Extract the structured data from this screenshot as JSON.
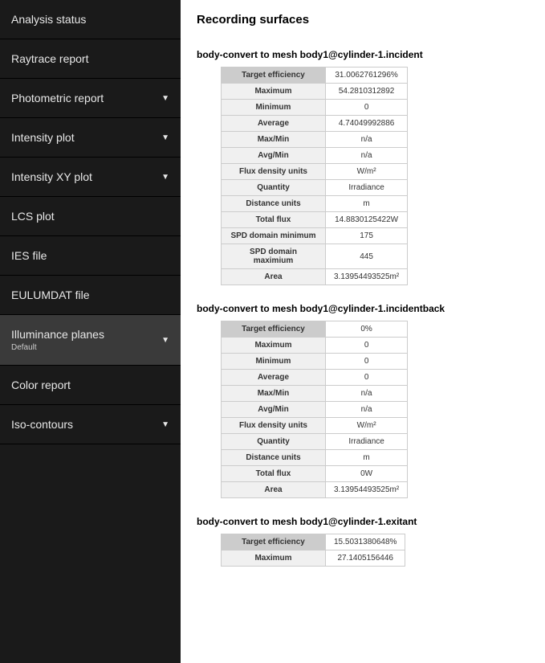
{
  "sidebar": {
    "items": [
      {
        "label": "Analysis status",
        "hasChevron": false,
        "selected": false
      },
      {
        "label": "Raytrace report",
        "hasChevron": false,
        "selected": false
      },
      {
        "label": "Photometric report",
        "hasChevron": true,
        "selected": false
      },
      {
        "label": "Intensity plot",
        "hasChevron": true,
        "selected": false
      },
      {
        "label": "Intensity XY plot",
        "hasChevron": true,
        "selected": false
      },
      {
        "label": "LCS plot",
        "hasChevron": false,
        "selected": false
      },
      {
        "label": "IES file",
        "hasChevron": false,
        "selected": false
      },
      {
        "label": "EULUMDAT file",
        "hasChevron": false,
        "selected": false
      },
      {
        "label": "Illuminance planes",
        "sublabel": "Default",
        "hasChevron": true,
        "selected": true
      },
      {
        "label": "Color report",
        "hasChevron": false,
        "selected": false
      },
      {
        "label": "Iso-contours",
        "hasChevron": true,
        "selected": false
      }
    ]
  },
  "main": {
    "title": "Recording surfaces",
    "sections": [
      {
        "title": "body-convert to mesh body1@cylinder-1.incident",
        "rows": [
          {
            "label": "Target efficiency",
            "value": "31.0062761296%",
            "highlight": true
          },
          {
            "label": "Maximum",
            "value": "54.2810312892"
          },
          {
            "label": "Minimum",
            "value": "0"
          },
          {
            "label": "Average",
            "value": "4.74049992886"
          },
          {
            "label": "Max/Min",
            "value": "n/a"
          },
          {
            "label": "Avg/Min",
            "value": "n/a"
          },
          {
            "label": "Flux density units",
            "value": "W/m²"
          },
          {
            "label": "Quantity",
            "value": "Irradiance"
          },
          {
            "label": "Distance units",
            "value": "m"
          },
          {
            "label": "Total flux",
            "value": "14.8830125422W"
          },
          {
            "label": "SPD domain minimum",
            "value": "175"
          },
          {
            "label": "SPD domain maximium",
            "value": "445"
          },
          {
            "label": "Area",
            "value": "3.13954493525m²"
          }
        ]
      },
      {
        "title": "body-convert to mesh body1@cylinder-1.incidentback",
        "rows": [
          {
            "label": "Target efficiency",
            "value": "0%",
            "highlight": true
          },
          {
            "label": "Maximum",
            "value": "0"
          },
          {
            "label": "Minimum",
            "value": "0"
          },
          {
            "label": "Average",
            "value": "0"
          },
          {
            "label": "Max/Min",
            "value": "n/a"
          },
          {
            "label": "Avg/Min",
            "value": "n/a"
          },
          {
            "label": "Flux density units",
            "value": "W/m²"
          },
          {
            "label": "Quantity",
            "value": "Irradiance"
          },
          {
            "label": "Distance units",
            "value": "m"
          },
          {
            "label": "Total flux",
            "value": "0W"
          },
          {
            "label": "Area",
            "value": "3.13954493525m²"
          }
        ]
      },
      {
        "title": "body-convert to mesh body1@cylinder-1.exitant",
        "rows": [
          {
            "label": "Target efficiency",
            "value": "15.5031380648%",
            "highlight": true
          },
          {
            "label": "Maximum",
            "value": "27.1405156446"
          }
        ]
      }
    ]
  }
}
